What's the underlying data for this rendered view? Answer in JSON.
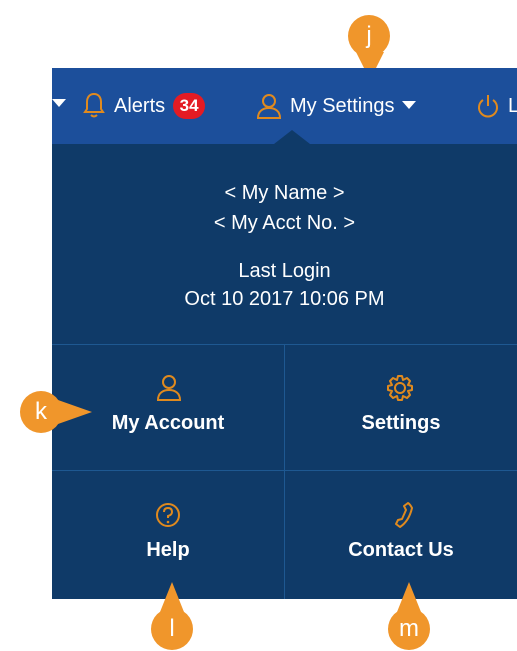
{
  "nav": {
    "alerts_label": "Alerts",
    "alerts_count": "34",
    "settings_label": "My Settings",
    "partial_label": "L"
  },
  "user": {
    "name": "< My Name >",
    "acct": "< My Acct No. >",
    "last_login_label": "Last Login",
    "last_login_value": "Oct 10 2017 10:06 PM"
  },
  "menu": {
    "my_account": "My Account",
    "settings": "Settings",
    "help": "Help",
    "contact_us": "Contact Us"
  },
  "callouts": {
    "j": "j",
    "k": "k",
    "l": "l",
    "m": "m"
  },
  "colors": {
    "navbar": "#1c4f9b",
    "panel": "#0f3a68",
    "badge": "#e41b23",
    "callout": "#f0962b",
    "icon": "#e08a1e"
  },
  "icons": [
    "bell-icon",
    "user-icon",
    "chevron-down-icon",
    "power-icon",
    "gear-icon",
    "help-icon",
    "phone-icon"
  ]
}
